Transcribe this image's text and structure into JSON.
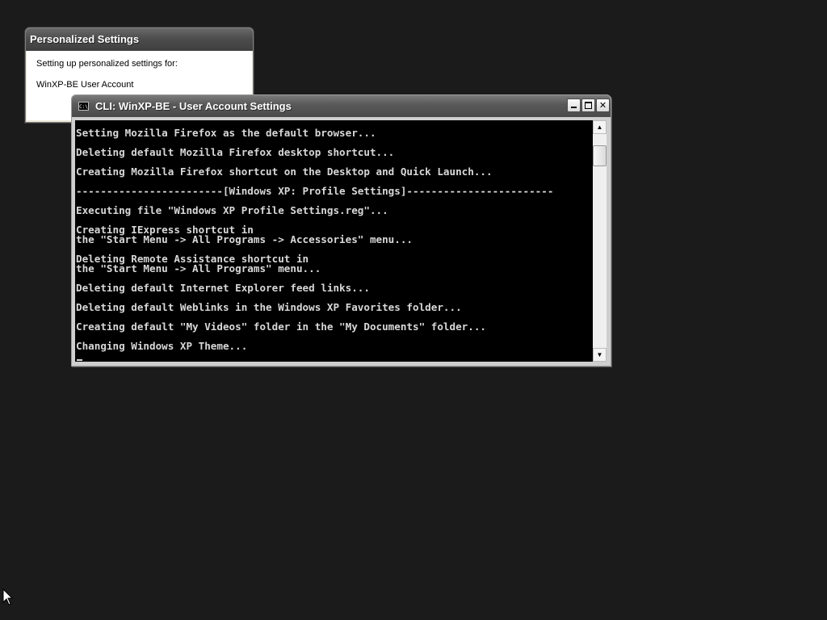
{
  "personalized_dialog": {
    "title": "Personalized Settings",
    "message": "Setting up personalized settings for:",
    "account": "WinXP-BE User Account"
  },
  "cli_window": {
    "title": "CLI: WinXP-BE - User Account Settings",
    "icon": "console-icon",
    "icon_text": "C:\\",
    "buttons": {
      "minimize": "minimize-icon",
      "maximize": "maximize-icon",
      "close": "close-icon",
      "close_label": "✕"
    },
    "console_text": "Setting Mozilla Firefox as the default browser...\n\nDeleting default Mozilla Firefox desktop shortcut...\n\nCreating Mozilla Firefox shortcut on the Desktop and Quick Launch...\n\n------------------------[Windows XP: Profile Settings]------------------------\n\nExecuting file \"Windows XP Profile Settings.reg\"...\n\nCreating IExpress shortcut in\nthe \"Start Menu -> All Programs -> Accessories\" menu...\n\nDeleting Remote Assistance shortcut in\nthe \"Start Menu -> All Programs\" menu...\n\nDeleting default Internet Explorer feed links...\n\nDeleting default Weblinks in the Windows XP Favorites folder...\n\nCreating default \"My Videos\" folder in the \"My Documents\" folder...\n\nChanging Windows XP Theme...",
    "scrollbar": {
      "up_arrow": "▲",
      "down_arrow": "▼"
    }
  },
  "colors": {
    "desktop_background": "#1b1b1b",
    "console_background": "#000000",
    "console_text": "#d8d8d8"
  }
}
